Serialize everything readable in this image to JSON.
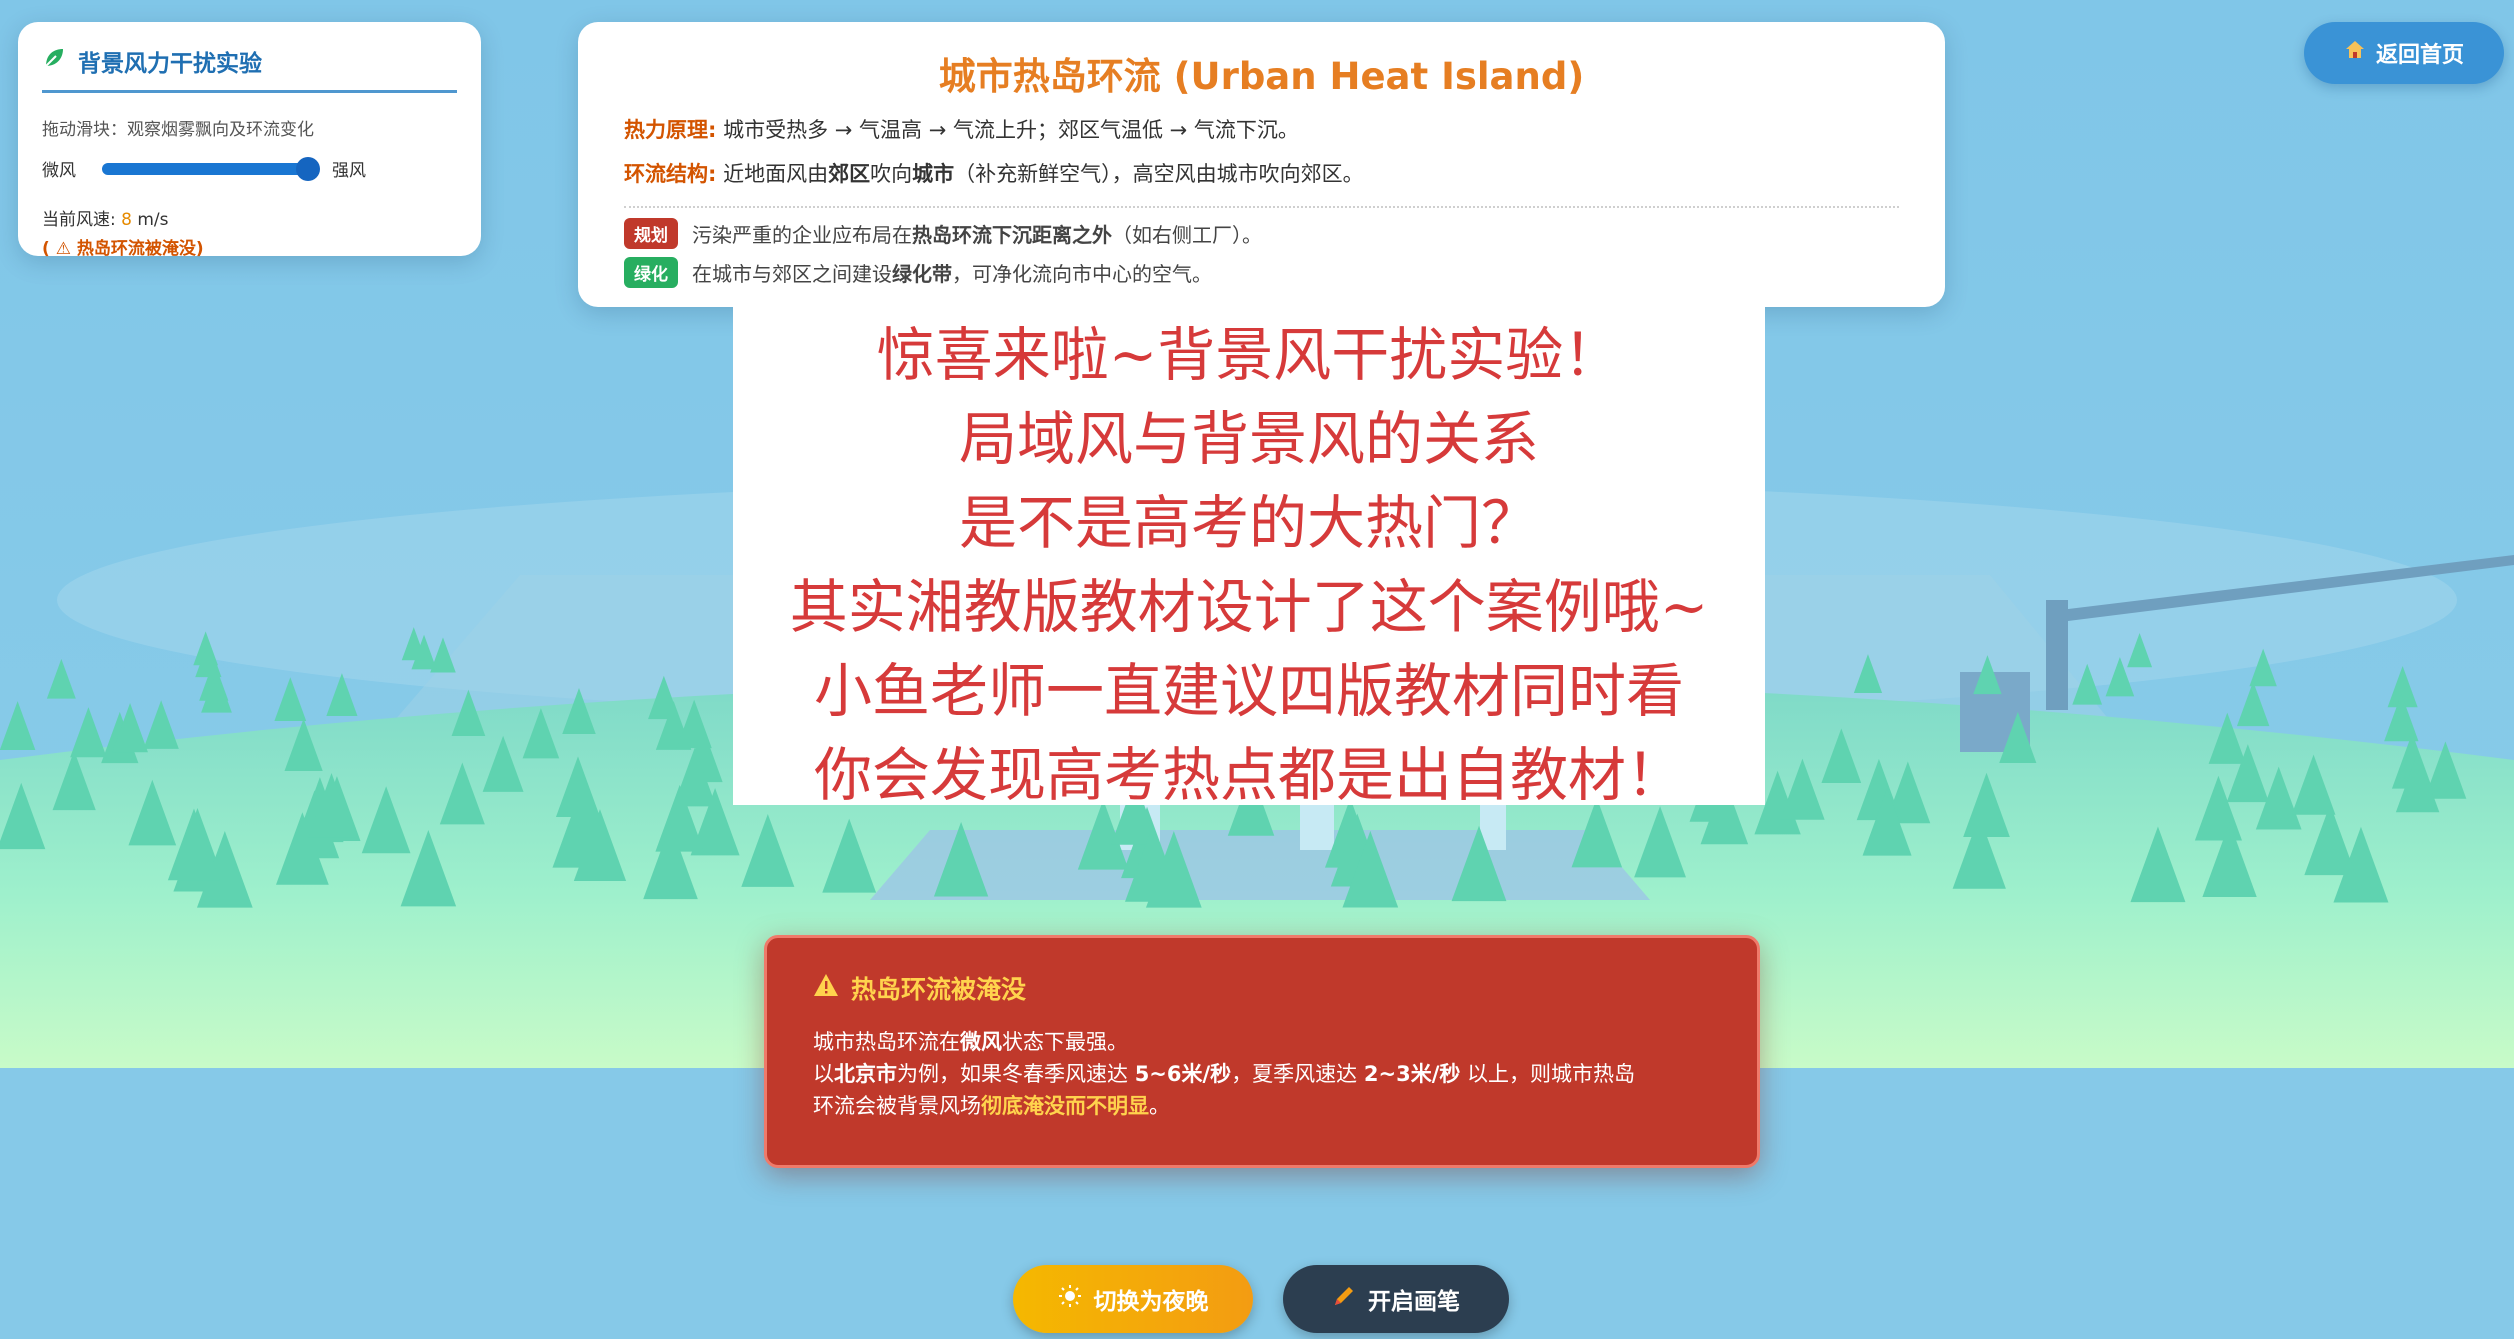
{
  "wind_panel": {
    "title": "背景风力干扰实验",
    "hint": "拖动滑块：观察烟雾飘向及环流变化",
    "slider_min_label": "微风",
    "slider_max_label": "强风",
    "slider_level": 1.0,
    "speed_label": "当前风速: ",
    "speed_value": "8",
    "speed_unit": " m/s",
    "status": "( ⚠ 热岛环流被淹没)"
  },
  "info_panel": {
    "title": "城市热岛环流 (Urban Heat Island)",
    "principle_label": "热力原理:",
    "principle_text": "城市受热多 → 气温高 → 气流上升；郊区气温低 → 气流下沉。",
    "structure_label": "环流结构:",
    "structure_text_1": "近地面风由",
    "structure_bold_1": "郊区",
    "structure_text_2": "吹向",
    "structure_bold_2": "城市",
    "structure_text_3": "（补充新鲜空气），高空风由城市吹向郊区。",
    "planning_tag": "规划",
    "planning_text_1": "污染严重的企业应布局在",
    "planning_bold": "热岛环流下沉距离之外",
    "planning_text_2": "（如右侧工厂）。",
    "green_tag": "绿化",
    "green_text_1": "在城市与郊区之间建设",
    "green_bold": "绿化带",
    "green_text_2": "，可净化流向市中心的空气。"
  },
  "home_button": {
    "label": "返回首页"
  },
  "promo": {
    "lines": [
      "惊喜来啦~背景风干扰实验！",
      "局域风与背景风的关系",
      "是不是高考的大热门？",
      "其实湘教版教材设计了这个案例哦~",
      "小鱼老师一直建议四版教材同时看",
      "你会发现高考热点都是出自教材！"
    ]
  },
  "alert": {
    "title": "热岛环流被淹没",
    "l1_a": "城市热岛环流在",
    "l1_b": "微风",
    "l1_c": "状态下最强。",
    "l2_a": "以",
    "l2_b": "北京市",
    "l2_c": "为例，如果冬春季风速达 ",
    "l2_d": "5~6米/秒",
    "l2_e": "，夏季风速达 ",
    "l2_f": "2~3米/秒",
    "l2_g": " 以上，则城市热岛",
    "l3_a": "环流会被背景风场",
    "l3_b": "彻底淹没而不明显",
    "l3_c": "。"
  },
  "buttons": {
    "night_label": "切换为夜晚",
    "pen_label": "开启画笔"
  },
  "colors": {
    "sky": "#86c9e8",
    "ground": "#a8f0cf",
    "tree": "#5fd3b0",
    "accent": "#e67e22",
    "alert": "#c0392b"
  }
}
